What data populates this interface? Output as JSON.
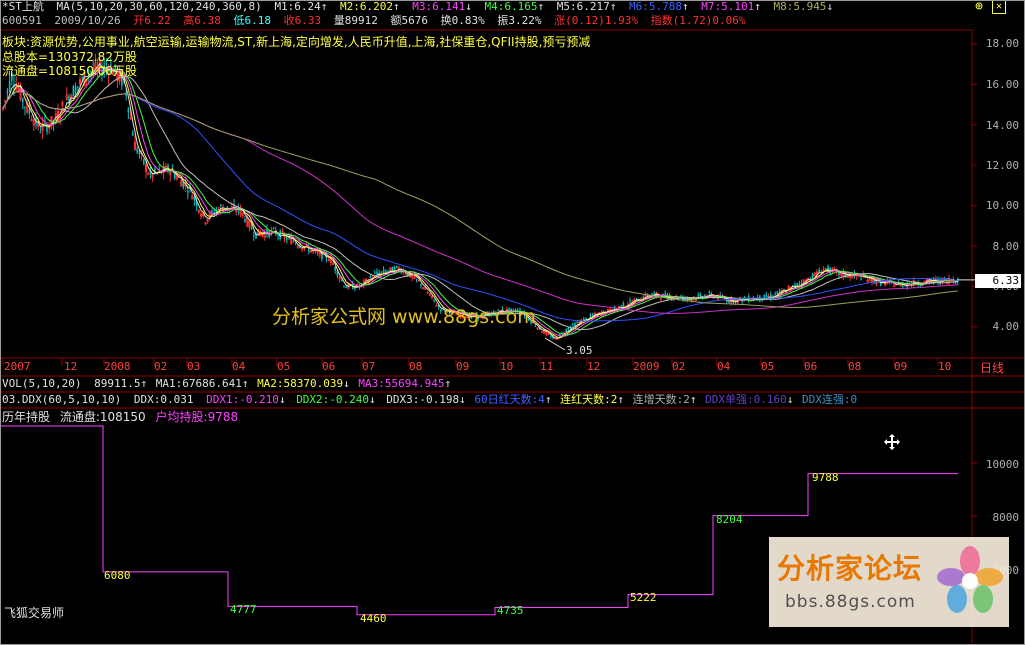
{
  "header": {
    "stock_name": "*ST上航",
    "ma_params": "MA(5,10,20,30,60,120,240,360,8)",
    "m1": "M1:6.24",
    "m2": "M2:6.202",
    "m3": "M3:6.141",
    "m4": "M4:6.165",
    "m5": "M5:6.217",
    "m6": "M6:5.788",
    "m7": "M7:5.101",
    "m8": "M8:5.945",
    "arrow_up": "↑",
    "arrow_down": "↓",
    "close_btn": "✕",
    "tool_btn": "⊕"
  },
  "quote": {
    "code": "600591",
    "date": "2009/10/26",
    "open": "开6.22",
    "high": "高6.38",
    "low": "低6.18",
    "close": "收6.33",
    "volume": "量89912",
    "amount": "额5676",
    "turnover": "换0.83%",
    "amplitude": "振3.22%",
    "change": "涨(0.12)1.93%",
    "index": "指数(1.72)0.06%"
  },
  "info": {
    "sector": "板块:资源优势,公用事业,航空运输,运输物流,ST,新上海,定向增发,人民币升值,上海,社保重仓,QFII持股,预亏预减",
    "total_shares": "总股本=130372.82万股",
    "float_shares": "流通盘=108150.00万股"
  },
  "price_axis": [
    "18.00",
    "16.00",
    "14.00",
    "12.00",
    "10.00",
    "8.00",
    "6.00",
    "4.00"
  ],
  "current_price": "6.33",
  "low_marker": "3.05",
  "watermark_center": "分析家公式网  www.88gs.com",
  "x_axis": {
    "ticks": [
      "2007",
      "12",
      "2008",
      "02",
      "03",
      "04",
      "05",
      "06",
      "07",
      "08",
      "09",
      "10",
      "11",
      "12",
      "2009",
      "02",
      "04",
      "05",
      "06",
      "08",
      "09",
      "10"
    ],
    "period": "日线"
  },
  "vol_panel": {
    "title": "VOL(5,10,20)",
    "value": "89911.5",
    "ma1": "MA1:67686.641",
    "ma2": "MA2:58370.039",
    "ma3": "MA3:55694.945"
  },
  "ddx_panel": {
    "title": "03.DDX(60,5,10,10)",
    "ddx": "DDX:0.031",
    "ddx1": "DDX1:-0.210",
    "ddx2": "DDX2:-0.240",
    "ddx3": "DDX3:-0.198",
    "red_days_recent": "60日红天数:4",
    "red_days_consec": "连红天数:2",
    "inc_days": "连增天数:2",
    "ddx_single": "DDX单强:0.160",
    "ddx_consec": "DDX连强:0"
  },
  "holders_panel": {
    "title": "历年持股",
    "float": "流通盘:108150",
    "avg": "户均持股:9788",
    "axis": [
      "10000",
      "8000",
      "6000"
    ],
    "step_labels": [
      "6080",
      "4777",
      "4460",
      "4735",
      "5222",
      "8204",
      "9788"
    ],
    "step_values": [
      12000,
      6080,
      4777,
      4460,
      4735,
      5222,
      8204,
      9788
    ]
  },
  "footer": {
    "brand": "飞狐交易师"
  },
  "forum_watermark": {
    "title": "分析家论坛",
    "url": "bbs.88gs.com"
  },
  "colors": {
    "bg": "#000000",
    "grid": "#8b0000",
    "up": "#ff3030",
    "down": "#00c0c0",
    "yellow": "#ffff40",
    "white": "#e0e0e0",
    "magenta": "#ff40ff",
    "green": "#40ff40",
    "blue": "#4060ff"
  }
}
